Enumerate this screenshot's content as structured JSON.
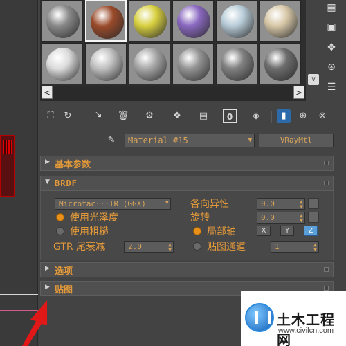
{
  "material_slots": [
    {
      "color": "#8a8a8a",
      "active": false
    },
    {
      "color": "#9a4a2a",
      "active": true
    },
    {
      "color": "#d8d040",
      "active": false
    },
    {
      "color": "#8a68c0",
      "active": false
    },
    {
      "color": "#b8ccd8",
      "active": false
    },
    {
      "color": "#d8c8a8",
      "active": false
    },
    {
      "color": "#dcdcdc",
      "active": false
    },
    {
      "color": "#c0c0c0",
      "active": false
    },
    {
      "color": "#a8a8a8",
      "active": false
    },
    {
      "color": "#949494",
      "active": false
    },
    {
      "color": "#808080",
      "active": false
    },
    {
      "color": "#6c6c6c",
      "active": false
    }
  ],
  "slot_nav": {
    "left": "<",
    "right": ">"
  },
  "toolbar": {
    "icons": [
      "pick-material-icon",
      "put-to-scene-icon",
      "assign-to-selection-icon",
      "delete-icon",
      "make-unique-icon",
      "put-to-library-icon",
      "material-id-icon",
      "show-in-viewport-icon",
      "show-end-result-icon",
      "go-to-parent-icon",
      "go-forward-icon"
    ],
    "material_id": "0"
  },
  "material": {
    "name": "Material #15",
    "type": "VRayMtl"
  },
  "rollouts": {
    "basic": "基本参数",
    "brdf": "BRDF",
    "options": "选项",
    "maps": "贴图"
  },
  "brdf": {
    "type": "Microfac···TR (GGX)",
    "use_gloss": "使用光泽度",
    "use_rough": "使用粗糙",
    "gtr_label": "GTR 尾衰减",
    "gtr_value": "2.0",
    "aniso_label": "各向异性",
    "aniso_value": "0.0",
    "rotation_label": "旋转",
    "rotation_value": "0.0",
    "local_axis": "局部轴",
    "map_channel": "贴图通道",
    "map_channel_value": "1",
    "axis_x": "X",
    "axis_y": "Y",
    "axis_z": "Z"
  },
  "watermark": {
    "title": "土木工程网",
    "url": "www.civilcn.com"
  },
  "colors": {
    "accent": "#e2993a",
    "panel": "#434343",
    "selected": "#5a9fd8"
  }
}
